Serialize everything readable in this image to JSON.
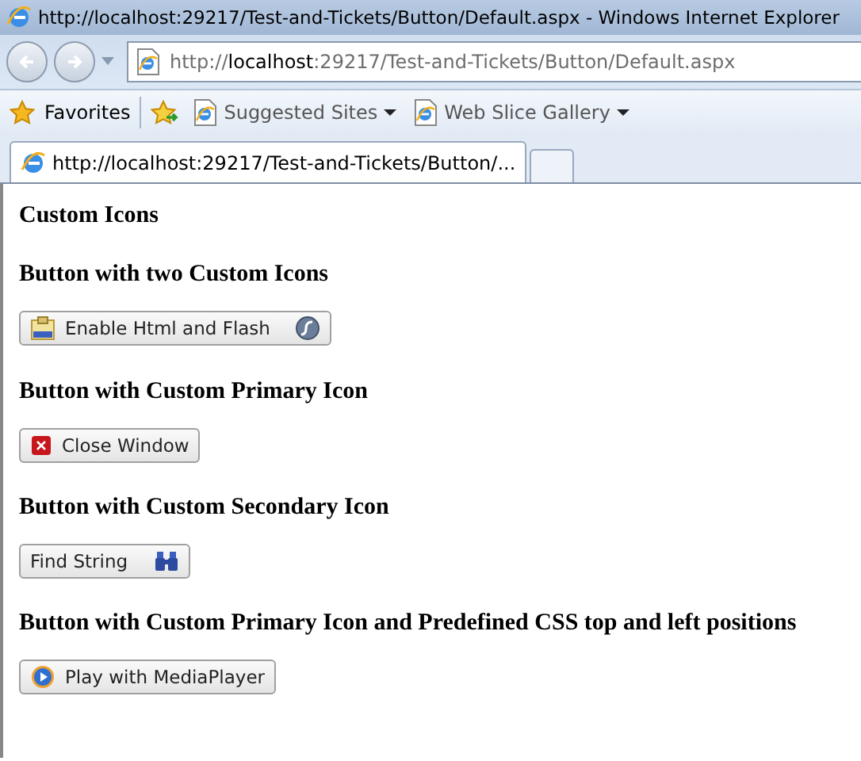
{
  "window": {
    "title": "http://localhost:29217/Test-and-Tickets/Button/Default.aspx - Windows Internet Explorer"
  },
  "address_bar": {
    "prefix": "http://",
    "host": "localhost",
    "rest": ":29217/Test-and-Tickets/Button/Default.aspx"
  },
  "favorites_bar": {
    "favorites": "Favorites",
    "links": [
      {
        "label": "Suggested Sites"
      },
      {
        "label": "Web Slice Gallery"
      }
    ]
  },
  "tabs": [
    {
      "label": "http://localhost:29217/Test-and-Tickets/Button/...",
      "selected": true
    }
  ],
  "page": {
    "title": "Custom Icons",
    "sections": [
      {
        "heading": "Button with two Custom Icons",
        "button": {
          "label": "Enable Html and Flash",
          "icon_left": {
            "kind": "html"
          },
          "icon_right": {
            "kind": "flash"
          }
        }
      },
      {
        "heading": "Button with Custom Primary Icon",
        "button": {
          "label": "Close Window",
          "icon_left": {
            "kind": "close"
          }
        }
      },
      {
        "heading": "Button with Custom Secondary Icon",
        "button": {
          "label": "Find String",
          "icon_right": {
            "kind": "binoculars"
          }
        }
      },
      {
        "heading": "Button with Custom Primary Icon and Predefined CSS top and left positions",
        "button": {
          "label": "Play with MediaPlayer",
          "icon_left": {
            "kind": "play"
          }
        }
      }
    ]
  }
}
